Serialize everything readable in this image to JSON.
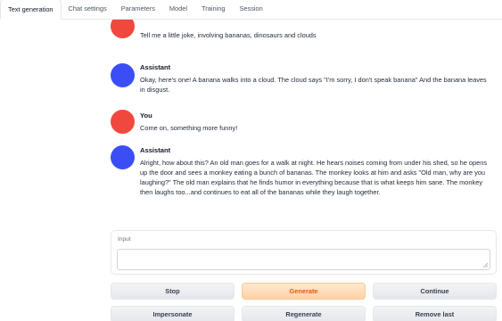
{
  "tabs": [
    {
      "label": "Text generation",
      "active": true
    },
    {
      "label": "Chat settings",
      "active": false
    },
    {
      "label": "Parameters",
      "active": false
    },
    {
      "label": "Model",
      "active": false
    },
    {
      "label": "Training",
      "active": false
    },
    {
      "label": "Session",
      "active": false
    }
  ],
  "messages": [
    {
      "role": "user",
      "name": "",
      "text": "Tell me a little joke, involving bananas, dinosaurs and clouds"
    },
    {
      "role": "assistant",
      "name": "Assistant",
      "text": "Okay, here's one! A banana walks into a cloud. The cloud says \"I'm sorry, I don't speak banana\" And the banana leaves in disgust."
    },
    {
      "role": "user",
      "name": "You",
      "text": "Come on, something more funny!"
    },
    {
      "role": "assistant",
      "name": "Assistant",
      "text": "Alright, how about this? An old man goes for a walk at night. He hears noises coming from under his shed, so he opens up the door and sees a monkey eating a bunch of bananas. The monkey looks at him and asks \"Old man, why are you laughing?\" The old man explains that he finds humor in everything because that is what keeps him sane. The monkey then laughs too...and continues to eat all of the bananas while they laugh together."
    }
  ],
  "input": {
    "label": "Input",
    "value": "",
    "placeholder": ""
  },
  "buttons": {
    "stop": "Stop",
    "generate": "Generate",
    "continue": "Continue",
    "impersonate": "Impersonate",
    "regenerate": "Regenerate",
    "remove_last": "Remove last"
  },
  "colors": {
    "user_avatar": "#f0483e",
    "assistant_avatar": "#3b4ef6",
    "accent": "#ea580c"
  }
}
